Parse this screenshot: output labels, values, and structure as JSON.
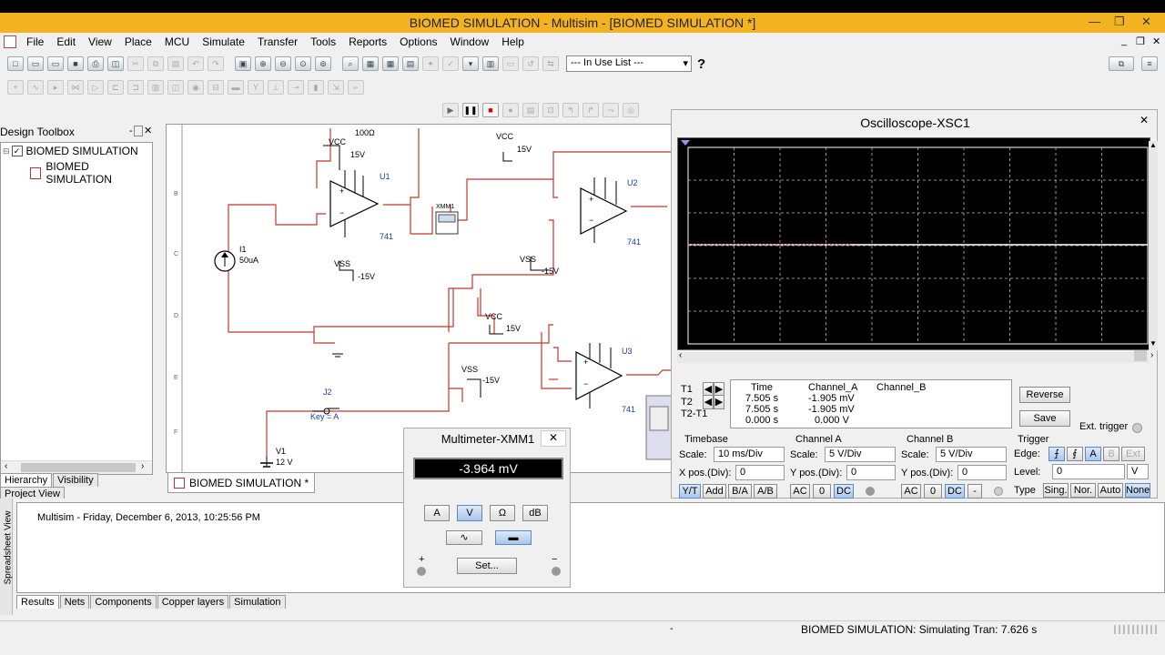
{
  "window": {
    "title": "BIOMED SIMULATION - Multisim - [BIOMED SIMULATION *]"
  },
  "menu": [
    "File",
    "Edit",
    "View",
    "Place",
    "MCU",
    "Simulate",
    "Transfer",
    "Tools",
    "Reports",
    "Options",
    "Window",
    "Help"
  ],
  "toolbar": {
    "in_use_list": "--- In Use List ---",
    "help_icon": "?"
  },
  "toolbox": {
    "title": "Design Toolbox",
    "tree": [
      "BIOMED SIMULATION",
      "BIOMED SIMULATION"
    ],
    "tabs": [
      "Hierarchy",
      "Visibility",
      "Project View"
    ]
  },
  "sheet_tab": "BIOMED SIMULATION *",
  "schematic": {
    "labels": {
      "r100": "100Ω",
      "vcc1": "VCC",
      "v15a": "15V",
      "u1": "U1",
      "n741a": "741",
      "vss1": "VSS",
      "m15a": "-15V",
      "i1": "I1",
      "i1v": "50uA",
      "xmm": "XMM1",
      "vcc2": "VCC",
      "v15b": "15V",
      "u2": "U2",
      "n741b": "741",
      "vss2": "VSS",
      "m15b": "-15V",
      "vcc3": "VCC",
      "v15c": "15V",
      "u3": "U3",
      "n741c": "741",
      "vss3": "VSS",
      "m15c": "-15V",
      "j2": "J2",
      "key": "Key = A",
      "v1": "V1",
      "v1v": "12 V"
    },
    "ruler": [
      "B",
      "C",
      "D",
      "E",
      "F",
      "G"
    ]
  },
  "oscilloscope": {
    "title": "Oscilloscope-XSC1",
    "readout_headers": [
      "Time",
      "Channel_A",
      "Channel_B"
    ],
    "rows": [
      {
        "label": "T1",
        "time": "7.505 s",
        "a": "-1.905 mV",
        "b": ""
      },
      {
        "label": "T2",
        "time": "7.505 s",
        "a": "-1.905 mV",
        "b": ""
      },
      {
        "label": "T2-T1",
        "time": "0.000 s",
        "a": "0.000 V",
        "b": ""
      }
    ],
    "reverse": "Reverse",
    "save": "Save",
    "ext_trigger": "Ext. trigger",
    "timebase": {
      "title": "Timebase",
      "scale_label": "Scale:",
      "scale": "10 ms/Div",
      "pos_label": "X pos.(Div):",
      "pos": "0",
      "buttons": [
        "Y/T",
        "Add",
        "B/A",
        "A/B"
      ]
    },
    "channel_a": {
      "title": "Channel A",
      "scale_label": "Scale:",
      "scale": "5  V/Div",
      "pos_label": "Y pos.(Div):",
      "pos": "0",
      "buttons": [
        "AC",
        "0",
        "DC"
      ]
    },
    "channel_b": {
      "title": "Channel B",
      "scale_label": "Scale:",
      "scale": "5  V/Div",
      "pos_label": "Y pos.(Div):",
      "pos": "0",
      "buttons": [
        "AC",
        "0",
        "DC",
        "-"
      ]
    },
    "trigger": {
      "title": "Trigger",
      "edge_label": "Edge:",
      "level_label": "Level:",
      "level": "0",
      "level_unit": "V",
      "type_label": "Type",
      "edge_buttons": [
        "A",
        "B",
        "Ext"
      ],
      "type_buttons": [
        "Sing.",
        "Nor.",
        "Auto",
        "None"
      ]
    }
  },
  "multimeter": {
    "title": "Multimeter-XMM1",
    "reading": "-3.964 mV",
    "modes": [
      "A",
      "V",
      "Ω",
      "dB"
    ],
    "set": "Set...",
    "plus": "+",
    "minus": "−"
  },
  "spreadsheet": {
    "side_label": "Spreadsheet View",
    "message": "Multisim  -  Friday, December 6, 2013, 10:25:56 PM",
    "tabs": [
      "Results",
      "Nets",
      "Components",
      "Copper layers",
      "Simulation"
    ]
  },
  "status": {
    "dash": "-",
    "text": "BIOMED SIMULATION: Simulating Tran: 7.626 s"
  },
  "colors": {
    "title_bar": "#f3b321",
    "wire": "#c0392b",
    "scope_bg": "#000000",
    "trace": "#ffffff"
  }
}
